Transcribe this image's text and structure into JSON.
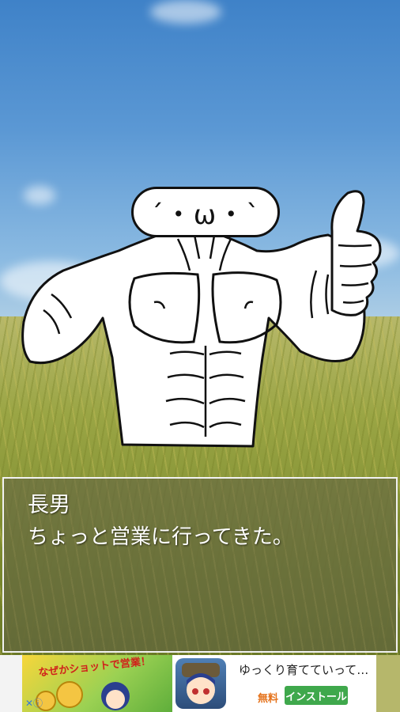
{
  "message": {
    "speaker": "長男",
    "text": "ちょっと営業に行ってきた。"
  },
  "character": {
    "face": "´・ω・`"
  },
  "ad": {
    "art_text": "なぜかショットで営業！",
    "title": "ゆっくり育てていって…",
    "free_label": "無料",
    "install_label": "インストール",
    "choice_icons": "✕ⓘ"
  }
}
